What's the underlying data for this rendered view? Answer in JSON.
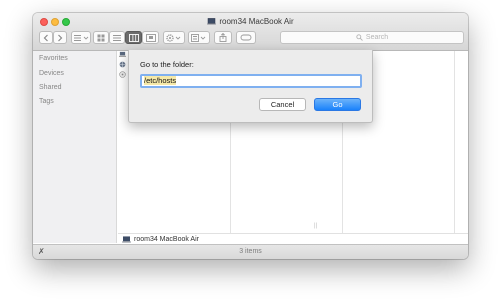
{
  "window": {
    "title": "room34 MacBook Air"
  },
  "toolbar": {
    "back_icon": "chevron-left-icon",
    "forward_icon": "chevron-right-icon",
    "search_placeholder": "Search"
  },
  "sidebar": {
    "items": [
      {
        "label": "Favorites"
      },
      {
        "label": "Devices"
      },
      {
        "label": "Shared"
      },
      {
        "label": "Tags"
      }
    ]
  },
  "dialog": {
    "label": "Go to the folder:",
    "input_value": "/etc/hosts",
    "cancel_label": "Cancel",
    "go_label": "Go"
  },
  "pathbar": {
    "label": "room34 MacBook Air"
  },
  "status": {
    "items_text": "3 items"
  },
  "colors": {
    "accent": "#1a82fb",
    "input_focus": "#7fb0f0",
    "highlight": "#f5e9a8"
  }
}
